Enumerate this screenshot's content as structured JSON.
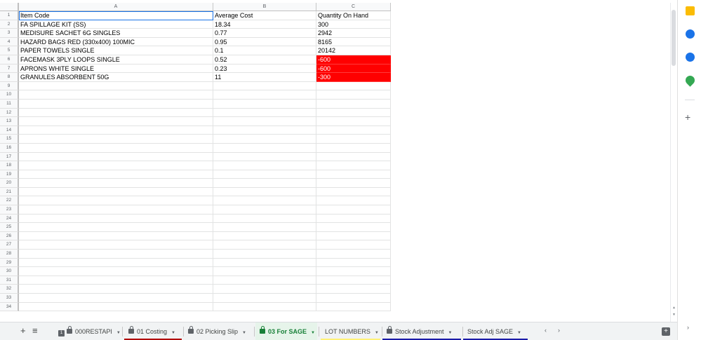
{
  "columns": [
    "A",
    "B",
    "C"
  ],
  "row_numbers": [
    "1",
    "2",
    "3",
    "4",
    "5",
    "6",
    "7",
    "8",
    "9",
    "10",
    "11",
    "12",
    "13",
    "14",
    "15",
    "16",
    "17",
    "18",
    "19",
    "20",
    "21",
    "22",
    "23",
    "24",
    "25",
    "26",
    "27",
    "28",
    "29",
    "30",
    "31",
    "32",
    "33",
    "34"
  ],
  "table": {
    "rows": [
      [
        "Item Code",
        "Average Cost",
        "Quantity On Hand"
      ],
      [
        "FA SPILLAGE KIT (SS)",
        "18.34",
        "300"
      ],
      [
        "MEDISURE SACHET 6G SINGLES",
        "0.77",
        "2942"
      ],
      [
        "HAZARD BAGS RED (330x400) 100MIC",
        "0.95",
        "8165"
      ],
      [
        "PAPER TOWELS SINGLE",
        "0.1",
        "20142"
      ],
      [
        "FACEMASK 3PLY LOOPS SINGLE",
        "0.52",
        "-600"
      ],
      [
        "APRONS WHITE SINGLE",
        "0.23",
        "-600"
      ],
      [
        "GRANULES ABSORBENT 50G",
        "11",
        "-300"
      ]
    ],
    "highlight_color": "#ff0000"
  },
  "tabs": {
    "add_icon": "+",
    "menu_icon": "≡",
    "items": [
      {
        "label": "000RESTAPI",
        "locked": true,
        "badge": "1",
        "active": false,
        "underline": ""
      },
      {
        "label": "01 Costing",
        "locked": true,
        "active": false,
        "underline": "#b00000"
      },
      {
        "label": "02 Picking Slip",
        "locked": true,
        "active": false,
        "underline": ""
      },
      {
        "label": "03 For SAGE",
        "locked": true,
        "active": true,
        "underline": ""
      },
      {
        "label": "LOT NUMBERS",
        "locked": false,
        "active": false,
        "underline": "#fff176"
      },
      {
        "label": "Stock Adjustment",
        "locked": true,
        "active": false,
        "underline": "#1a1aa8"
      },
      {
        "label": "Stock Adj SAGE",
        "locked": false,
        "active": false,
        "underline": "#1a1aa8"
      }
    ],
    "scroll_left": "‹",
    "scroll_right": "›"
  },
  "side_panel": {
    "icons": [
      {
        "name": "keep-icon",
        "color": "#fbbc04"
      },
      {
        "name": "tasks-icon",
        "color": "#1a73e8"
      },
      {
        "name": "contacts-icon",
        "color": "#1a73e8"
      },
      {
        "name": "maps-icon",
        "color": "#34a853"
      }
    ],
    "add_label": "+"
  }
}
